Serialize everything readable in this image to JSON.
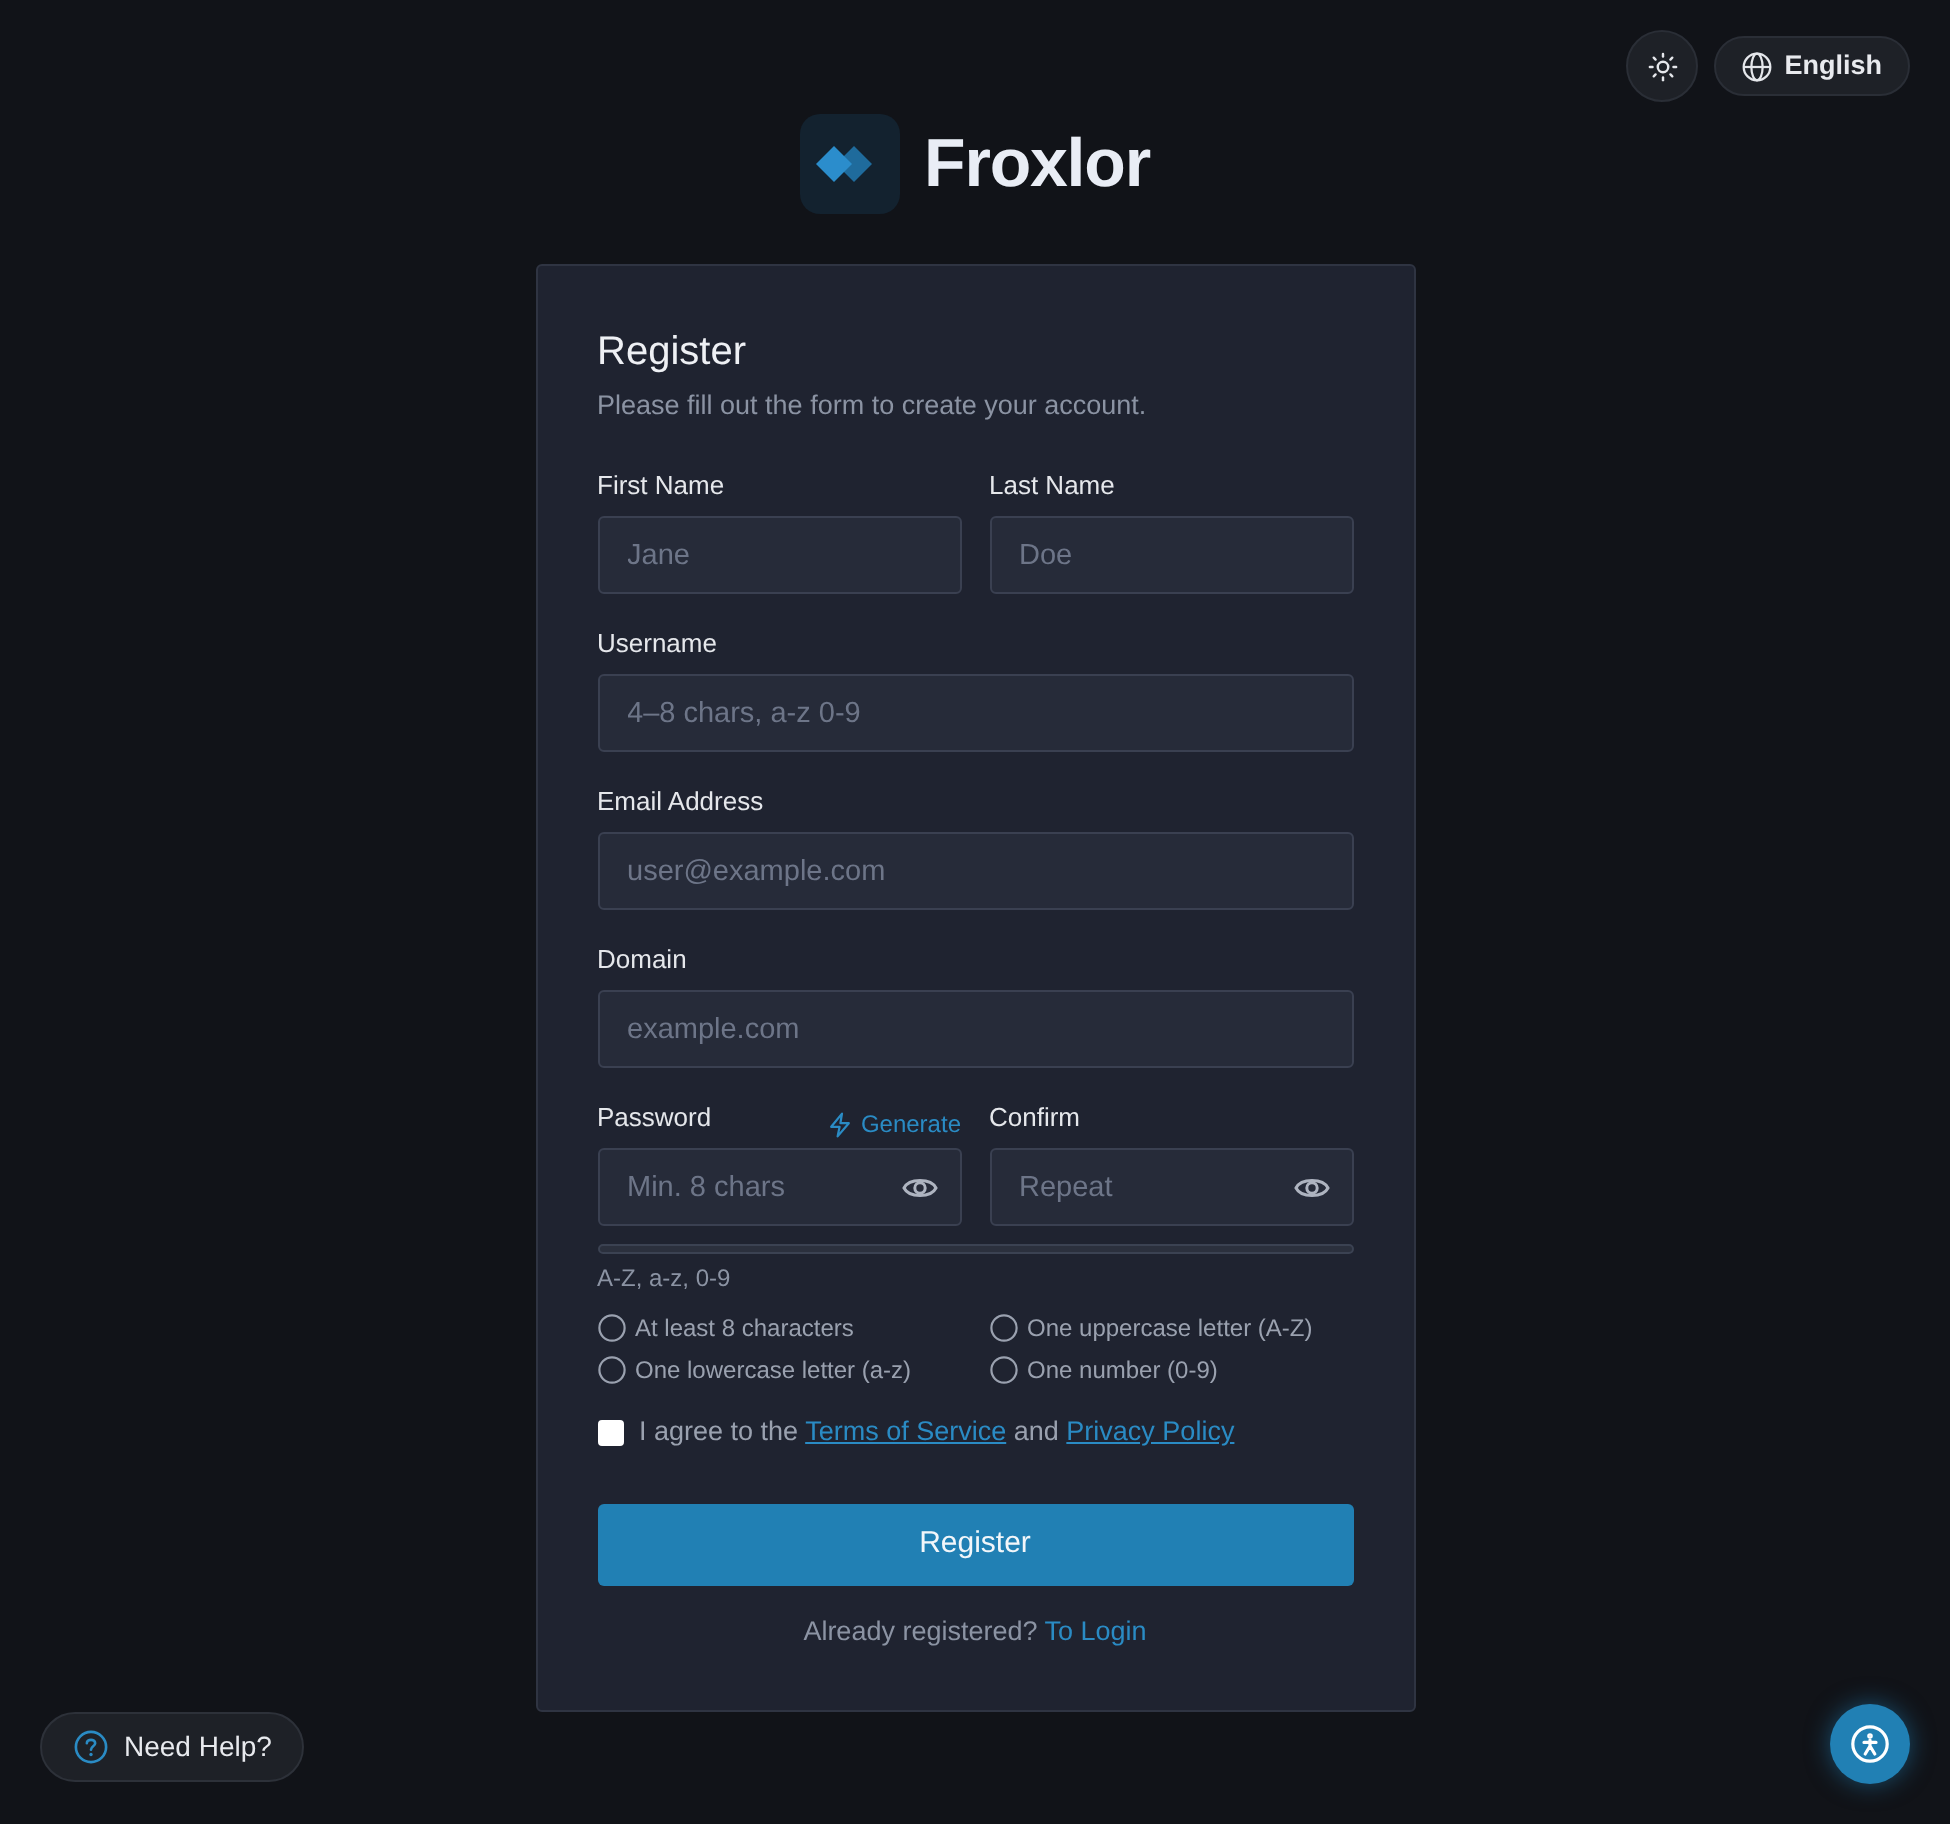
{
  "header": {
    "language": "English"
  },
  "brand": {
    "name": "Froxlor"
  },
  "form": {
    "title": "Register",
    "subtitle": "Please fill out the form to create your account.",
    "rows": [
      {
        "fields": [
          {
            "kind": "text",
            "label": "First Name",
            "placeholder": "Jane"
          },
          {
            "kind": "text",
            "label": "Last Name",
            "placeholder": "Doe"
          }
        ]
      },
      {
        "fields": [
          {
            "kind": "text",
            "label": "Username",
            "placeholder": "4–8 chars, a-z 0-9"
          }
        ]
      },
      {
        "fields": [
          {
            "kind": "text",
            "label": "Email Address",
            "placeholder": "user@example.com"
          }
        ]
      },
      {
        "fields": [
          {
            "kind": "text",
            "label": "Domain",
            "placeholder": "example.com"
          }
        ]
      },
      {
        "fields": [
          {
            "kind": "password",
            "label": "Password",
            "placeholder": "Min. 8 chars",
            "action": "Generate"
          },
          {
            "kind": "password",
            "label": "Confirm",
            "placeholder": "Repeat"
          }
        ]
      }
    ],
    "strength": {
      "level": 0,
      "hint": "A-Z, a-z, 0-9"
    },
    "requirements": [
      {
        "label": "At least 8 characters",
        "met": false
      },
      {
        "label": "One uppercase letter (A-Z)",
        "met": false
      },
      {
        "label": "One lowercase letter (a-z)",
        "met": false
      },
      {
        "label": "One number (0-9)",
        "met": false
      }
    ],
    "agreement": {
      "checked": false,
      "parts": [
        {
          "kind": "text",
          "text": "I agree to the"
        },
        {
          "kind": "link",
          "text": "Terms of Service"
        },
        {
          "kind": "text",
          "text": "and"
        },
        {
          "kind": "link",
          "text": "Privacy Policy"
        }
      ]
    },
    "submit": "Register",
    "footer": {
      "text": "Already registered?",
      "link": "To Login"
    }
  },
  "help": {
    "label": "Need Help?"
  }
}
